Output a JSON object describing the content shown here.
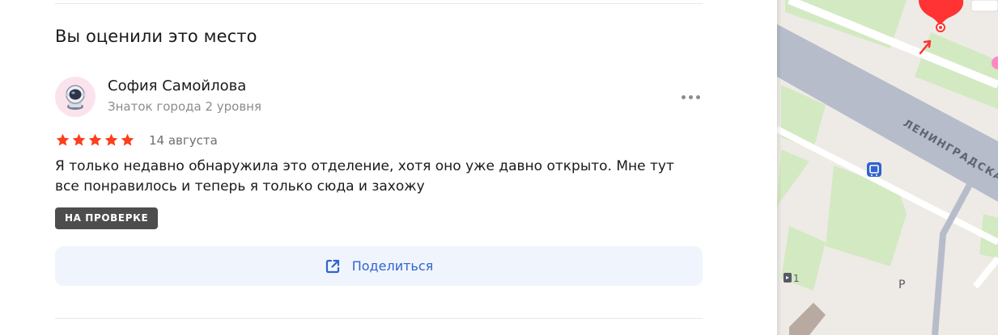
{
  "section": {
    "heading": "Вы оценили это место"
  },
  "review": {
    "author": {
      "name": "София Самойлова",
      "level": "Знаток города 2 уровня"
    },
    "rating": 5,
    "date": "14 августа",
    "text": "Я только недавно обнаружила это отделение, хотя оно уже давно открыто. Мне тут все понравилось и теперь я только сюда и захожу",
    "status_badge": "НА ПРОВЕРКЕ",
    "more_label": "more-options",
    "share_label": "Поделиться"
  },
  "map": {
    "street_label": "ЛЕНИНГРАДСКА",
    "parking_label": "P",
    "entrance_label": "1"
  },
  "colors": {
    "star": "#fc3f1d",
    "badge_bg": "#4d4d4d",
    "share_bg": "#f0f5fd",
    "link_blue": "#2f64d0",
    "map_road": "#b7bccb",
    "map_green": "#d3e9c2",
    "pin_red": "#f33"
  },
  "icons": {
    "more": "more-dots-icon",
    "share": "share-icon",
    "star": "star-icon",
    "avatar": "astronaut-avatar"
  }
}
